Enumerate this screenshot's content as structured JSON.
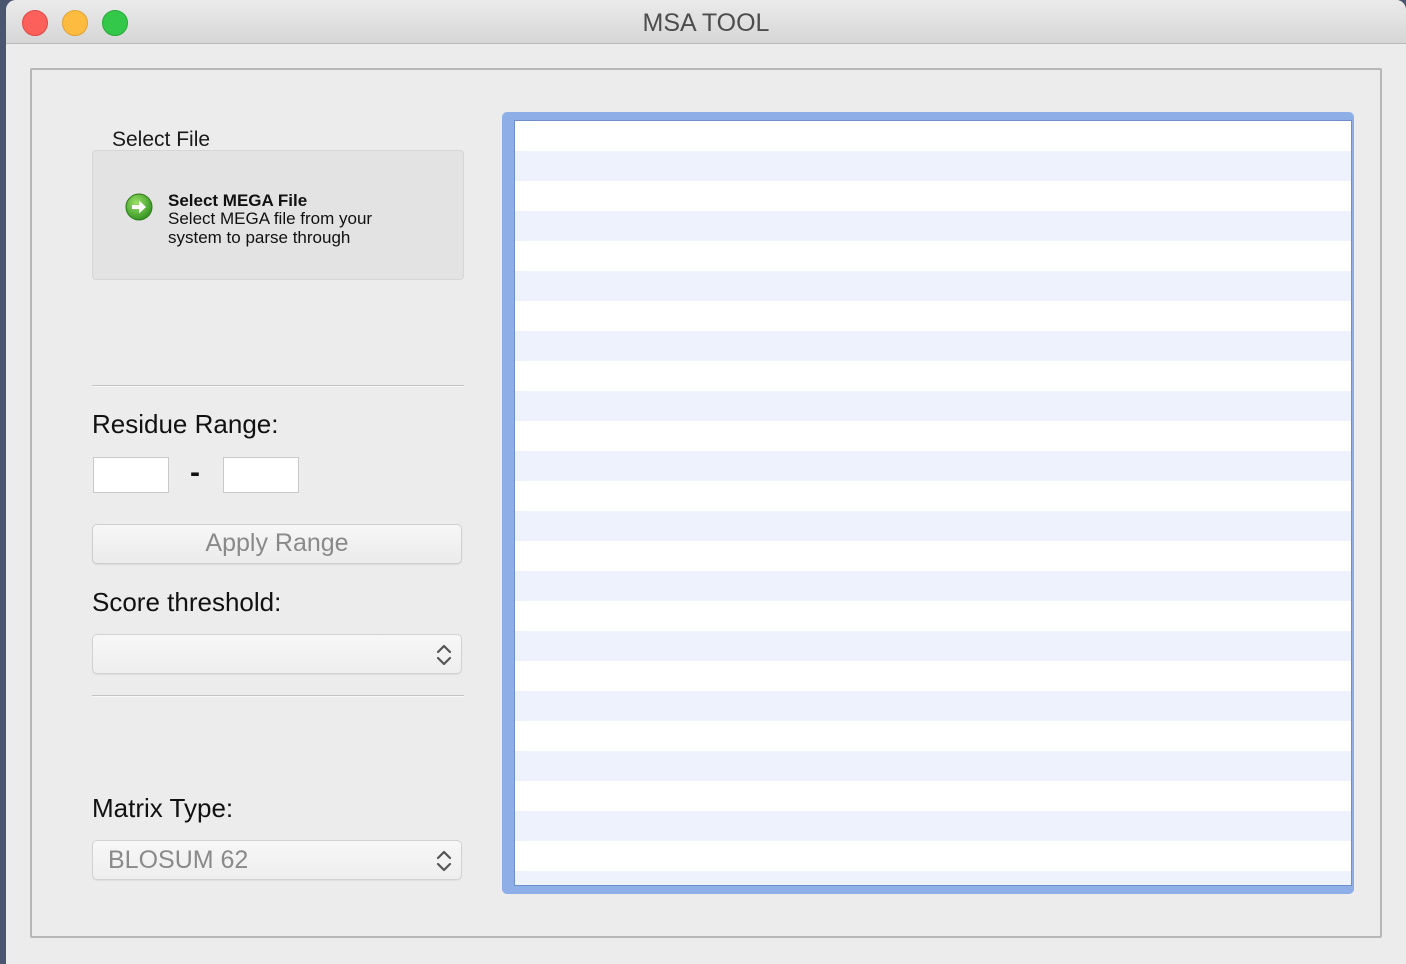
{
  "window": {
    "title": "MSA TOOL"
  },
  "file_group": {
    "label": "Select File",
    "button_title": "Select MEGA File",
    "button_description": "Select MEGA file from your system to parse through"
  },
  "residue_range": {
    "label": "Residue Range:",
    "start_value": "",
    "end_value": "",
    "separator": "-"
  },
  "apply_range": {
    "label": "Apply Range"
  },
  "score_threshold": {
    "label": "Score threshold:",
    "selected": ""
  },
  "matrix_type": {
    "label": "Matrix Type:",
    "selected": "BLOSUM 62"
  },
  "icons": {
    "select_file": "green-arrow-right-icon",
    "popup": "chevron-up-down-icon"
  },
  "colors": {
    "close": "#fc605b",
    "minimize": "#fdbc40",
    "maximize": "#34c84a",
    "list_focus": "#8eaee8",
    "list_stripe": "#edf2fc"
  }
}
